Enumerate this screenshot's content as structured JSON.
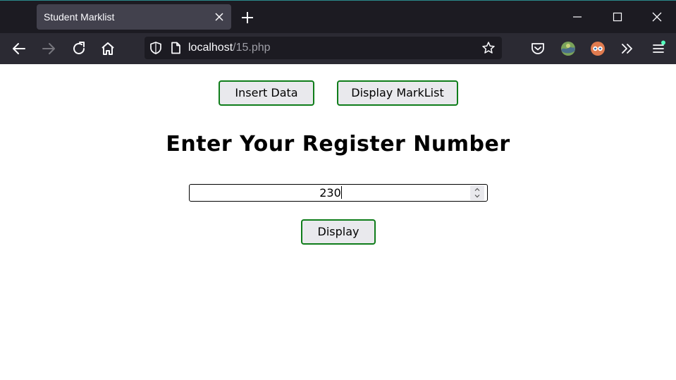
{
  "browser": {
    "tab_title": "Student Marklist",
    "url_host": "localhost",
    "url_path": "/15.php"
  },
  "page": {
    "insert_button": "Insert Data",
    "display_marklist_button": "Display MarkList",
    "heading": "Enter Your Register Number",
    "register_input_value": "230",
    "display_button": "Display"
  },
  "icons": {
    "tab_close": "close-icon",
    "new_tab": "plus-icon",
    "minimize": "minimize-icon",
    "maximize": "maximize-icon",
    "close_window": "close-icon",
    "back": "back-arrow-icon",
    "forward": "forward-arrow-icon",
    "reload": "reload-icon",
    "home": "home-icon",
    "shield": "shield-icon",
    "page": "page-icon",
    "bookmark": "star-icon",
    "pocket": "pocket-icon",
    "extension1": "extension-icon",
    "extension2": "extension-icon",
    "more_tools": "chevrons-right-icon",
    "menu": "hamburger-menu-icon"
  },
  "colors": {
    "button_border": "#0f7d1a",
    "button_bg": "#e9e9ed",
    "chrome_dark": "#1c1b22",
    "chrome_toolbar": "#2b2a33",
    "tab_bg": "#42414d"
  }
}
